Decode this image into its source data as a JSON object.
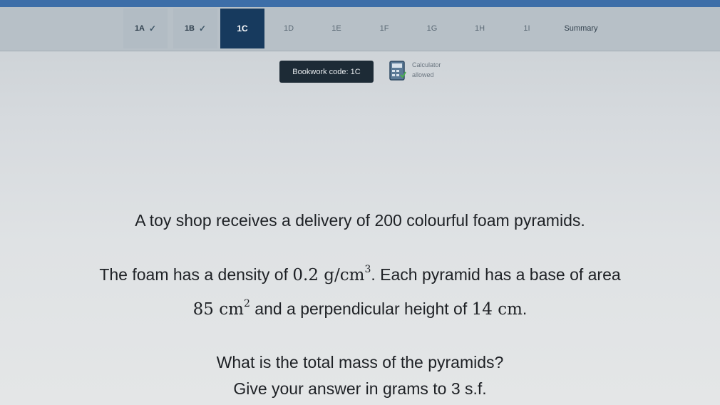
{
  "header": {
    "corner_text": "—"
  },
  "tabs": [
    {
      "label": "1A",
      "done": true
    },
    {
      "label": "1B",
      "done": true
    },
    {
      "label": "1C",
      "active": true
    },
    {
      "label": "1D"
    },
    {
      "label": "1E"
    },
    {
      "label": "1F"
    },
    {
      "label": "1G"
    },
    {
      "label": "1H"
    },
    {
      "label": "1I"
    },
    {
      "label": "Summary"
    }
  ],
  "bookwork": {
    "label": "Bookwork code: 1C"
  },
  "calculator": {
    "line1": "Calculator",
    "line2": "allowed"
  },
  "question": {
    "line1": "A toy shop receives a delivery of 200 colourful foam pyramids.",
    "line2_prefix": "The foam has a density of ",
    "density_value": "0.2",
    "density_unit": "g/cm",
    "density_exp": "3",
    "line2_suffix": ". Each pyramid has a base of area",
    "area_value": "85",
    "area_unit": "cm",
    "area_exp": "2",
    "line3_middle": " and a perpendicular height of ",
    "height_value": "14",
    "height_unit": "cm",
    "line3_end": ".",
    "line4": "What is the total mass of the pyramids?",
    "line5": "Give your answer in grams to 3 s.f."
  }
}
